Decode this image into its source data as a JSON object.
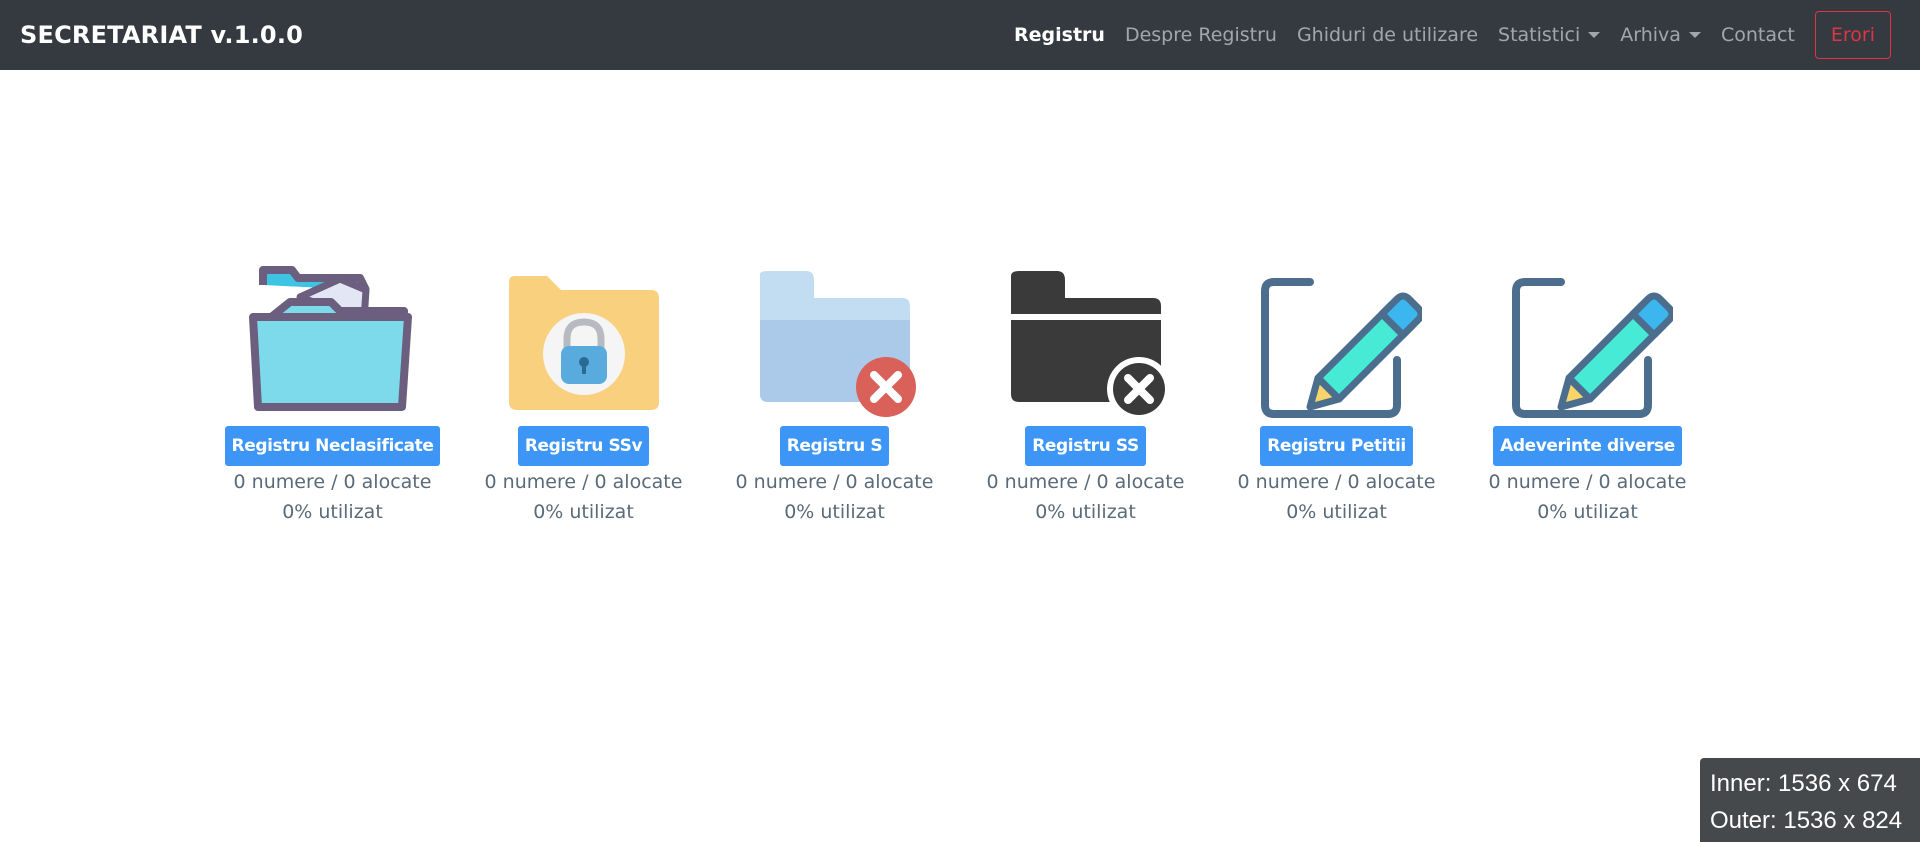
{
  "navbar": {
    "brand": "SECRETARIAT v.1.0.0",
    "links": [
      {
        "label": "Registru"
      },
      {
        "label": "Despre Registru"
      },
      {
        "label": "Ghiduri de utilizare"
      },
      {
        "label": "Statistici"
      },
      {
        "label": "Arhiva"
      },
      {
        "label": "Contact"
      }
    ],
    "errors_button": "Erori"
  },
  "registers": [
    {
      "title": "Registru Neclasificate",
      "counts": "0 numere / 0 alocate",
      "usage": "0% utilizat",
      "icon": "open-folder-icon"
    },
    {
      "title": "Registru SSv",
      "counts": "0 numere / 0 alocate",
      "usage": "0% utilizat",
      "icon": "locked-folder-icon"
    },
    {
      "title": "Registru S",
      "counts": "0 numere / 0 alocate",
      "usage": "0% utilizat",
      "icon": "folder-delete-icon"
    },
    {
      "title": "Registru SS",
      "counts": "0 numere / 0 alocate",
      "usage": "0% utilizat",
      "icon": "dark-folder-delete-icon"
    },
    {
      "title": "Registru Petitii",
      "counts": "0 numere / 0 alocate",
      "usage": "0% utilizat",
      "icon": "edit-pencil-icon"
    },
    {
      "title": "Adeverinte diverse",
      "counts": "0 numere / 0 alocate",
      "usage": "0% utilizat",
      "icon": "edit-pencil-icon"
    }
  ],
  "colors": {
    "navbar_bg": "#343a40",
    "primary_button": "#3d96f5",
    "danger": "#dc3545"
  },
  "window_size": {
    "inner": "Inner: 1536 x 674",
    "outer": "Outer: 1536 x 824"
  }
}
